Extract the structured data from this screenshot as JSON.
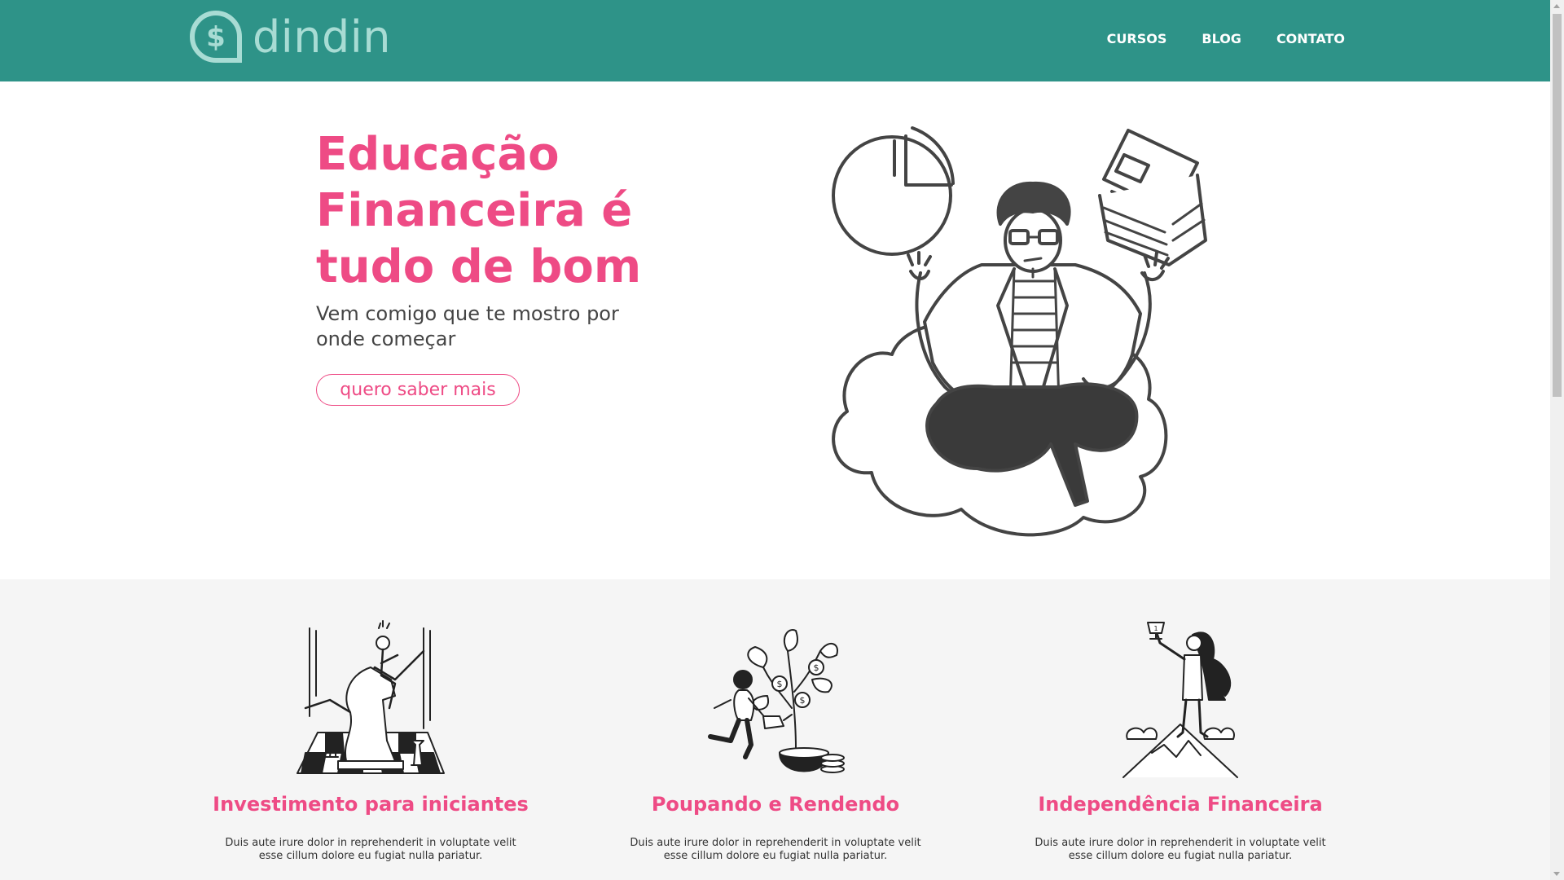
{
  "brand": {
    "name": "dindin",
    "logo_icon": "dollar-chat-bubble-icon"
  },
  "nav": {
    "items": [
      {
        "label": "CURSOS"
      },
      {
        "label": "BLOG"
      },
      {
        "label": "CONTATO"
      }
    ]
  },
  "hero": {
    "title": "Educação Financeira é tudo de bom",
    "subtitle": "Vem comigo que te mostro por onde começar",
    "cta_label": "quero saber mais",
    "illustration": "person-meditating-on-cloud-illustration"
  },
  "features": [
    {
      "title": "Investimento para iniciantes",
      "text": "Duis aute irure dolor in reprehenderit in voluptate velit esse cillum dolore eu fugiat nulla pariatur.",
      "illustration": "chess-knight-rider-illustration"
    },
    {
      "title": "Poupando e Rendendo",
      "text": "Duis aute irure dolor in reprehenderit in voluptate velit esse cillum dolore eu fugiat nulla pariatur.",
      "illustration": "money-tree-watering-illustration"
    },
    {
      "title": "Independência Financeira",
      "text": "Duis aute irure dolor in reprehenderit in voluptate velit esse cillum dolore eu fugiat nulla pariatur.",
      "illustration": "hero-on-mountain-trophy-illustration"
    }
  ],
  "colors": {
    "header": "#2e9388",
    "accent": "#ee4b85",
    "logo": "#a8dcd4",
    "section_bg": "#f5f5f5"
  }
}
